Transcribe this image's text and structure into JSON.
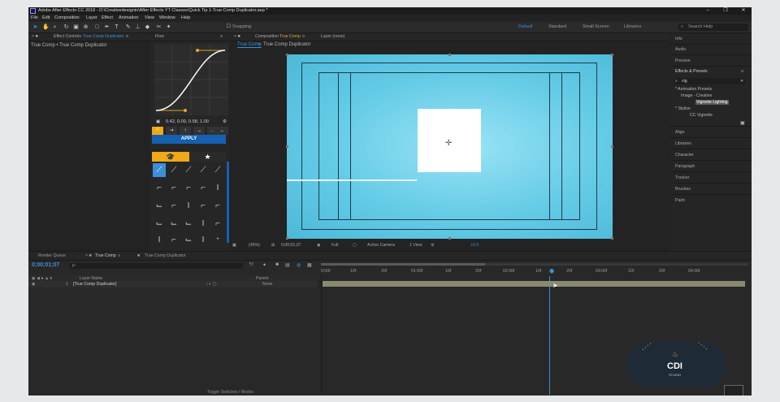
{
  "title_bar": {
    "title": "Adobe After Effects CC 2018 - D:\\Creativedesignin\\After Effects YT Classes\\Quick Tip 1-True Comp Duplicator.aep *",
    "controls": [
      "–",
      "❐",
      "✕"
    ]
  },
  "menu": [
    "File",
    "Edit",
    "Composition",
    "Layer",
    "Effect",
    "Animation",
    "View",
    "Window",
    "Help"
  ],
  "toolbar": {
    "snapping_label": "Snapping",
    "workspaces": [
      "Default",
      "Standard",
      "Small Screen",
      "Libraries"
    ],
    "active_workspace": "Default",
    "search_placeholder": "Search Help"
  },
  "effect_controls": {
    "tab": "Effect Controls",
    "tab_target": "True Comp Duplicator",
    "breadcrumb": "True Comp • True Comp Duplicator"
  },
  "flow": {
    "title": "Flow",
    "values": "0.42, 0.00, 0.58, 1.00",
    "apply_label": "APPLY",
    "preset_icons": [
      "graduation-cap-icon",
      "star-icon"
    ]
  },
  "composition": {
    "tab": "Composition",
    "tab_target": "True Comp",
    "layer_tab": "Layer (none)",
    "breadcrumb": "True Comp",
    "breadcrumb2": "True Comp Duplicator",
    "zoom": "(45%)",
    "timecode": "0;00;01;07",
    "resolution": "Full",
    "camera": "Active Camera",
    "view": "1 View",
    "offset": "+0.0"
  },
  "right_panel": {
    "items_top": [
      "Info",
      "Audio",
      "Preview"
    ],
    "effects_presets_title": "Effects & Presets",
    "search_value": "vig",
    "tree": [
      "* Animation Presets",
      "Image - Creative",
      "Vignette Lighting",
      "* Stylize",
      "CC Vignette"
    ],
    "items_bottom": [
      "Align",
      "Libraries",
      "Character",
      "Paragraph",
      "Tracker",
      "Brushes",
      "Paint"
    ]
  },
  "timeline": {
    "tabs": [
      "Render Queue",
      "True Comp",
      "True Comp Duplicator"
    ],
    "current_time": "0;00;01;07",
    "search_placeholder": "ρ-",
    "columns": {
      "layer_name": "Layer Name",
      "parent": "Parent"
    },
    "layer": {
      "num": "1",
      "name": "[True Comp Duplicator]",
      "parent": "None"
    },
    "ruler": [
      "0:00f",
      "10f",
      "20f",
      "01:00f",
      "10f",
      "20f",
      "02:00f",
      "10f",
      "20f",
      "03:00f",
      "10f",
      "20f",
      "04:00f"
    ],
    "footer": "Toggle Switches / Modes"
  },
  "watermark": {
    "logo_text": "CDI",
    "sub": "STUDIO"
  },
  "colors": {
    "accent_blue": "#3a8fd8",
    "accent_orange": "#e8a33a",
    "apply_blue": "#1560b0",
    "comp_bg": "#64cbe6",
    "flow_yellow": "#f0a818"
  }
}
